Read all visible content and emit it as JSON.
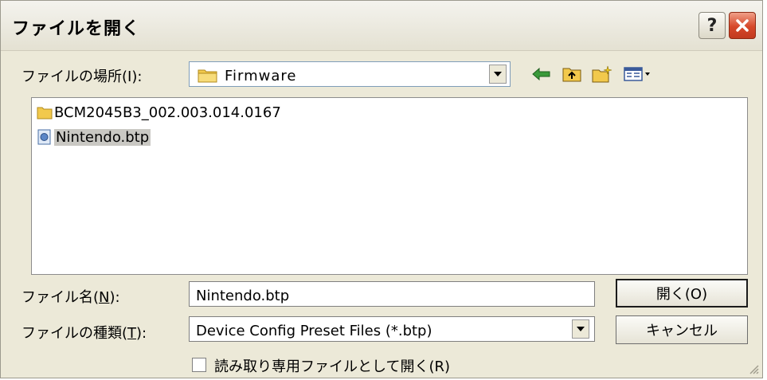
{
  "dialog": {
    "title": "ファイルを開く",
    "help_label": "?",
    "close_label": "✕"
  },
  "location": {
    "label": "ファイルの場所(I):",
    "folder": "Firmware"
  },
  "files": [
    {
      "name": "BCM2045B3_002.003.014.0167",
      "type": "folder",
      "selected": false
    },
    {
      "name": "Nintendo.btp",
      "type": "file",
      "selected": true
    }
  ],
  "filename": {
    "label_prefix": "ファイル名(",
    "label_key": "N",
    "label_suffix": "):",
    "value": "Nintendo.btp"
  },
  "filetype": {
    "label_prefix": "ファイルの種類(",
    "label_key": "T",
    "label_suffix": "):",
    "value": "Device Config Preset Files (*.btp)"
  },
  "readonly": {
    "label": "読み取り専用ファイルとして開く(R)",
    "checked": false
  },
  "buttons": {
    "open": "開く(O)",
    "cancel": "キャンセル"
  },
  "icons": {
    "back": "back-arrow-icon",
    "up": "up-folder-icon",
    "new_folder": "new-folder-icon",
    "view_menu": "view-menu-icon"
  },
  "colors": {
    "dialog_bg": "#ece9d8",
    "close_red": "#d6482a",
    "folder_yellow": "#f2c94c",
    "back_green": "#3a9a3a"
  }
}
